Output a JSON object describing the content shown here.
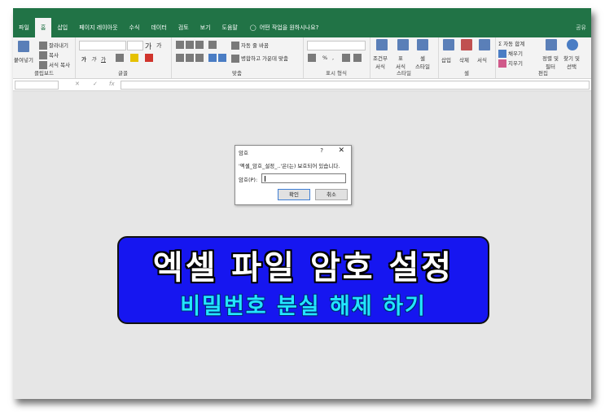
{
  "ribbon": {
    "tabs": [
      "파일",
      "홈",
      "삽입",
      "페이지 레이아웃",
      "수식",
      "데이터",
      "검토",
      "보기",
      "도움말"
    ],
    "tell_me": "어떤 작업을 원하시나요?",
    "share": "공유"
  },
  "clipboard": {
    "paste": "붙여넣기",
    "cut": "잘라내기",
    "copy": "복사",
    "format_painter": "서식 복사",
    "label": "클립보드"
  },
  "font": {
    "bold": "가",
    "italic": "가",
    "underline": "가",
    "grow": "가",
    "shrink": "가",
    "label": "글꼴"
  },
  "alignment": {
    "wrap": "자동 줄 바꿈",
    "merge": "병합하고 가운데 맞춤",
    "label": "맞춤"
  },
  "number": {
    "percent": "%",
    "comma": ",",
    "label": "표시 형식"
  },
  "styles": {
    "conditional": "조건부\n서식",
    "table": "표\n서식",
    "cell": "셀\n스타일",
    "label": "스타일"
  },
  "cells": {
    "insert": "삽입",
    "delete": "삭제",
    "format": "서식",
    "label": "셀"
  },
  "editing": {
    "autosum": "자동 합계",
    "fill": "채우기",
    "clear": "지우기",
    "sort": "정렬 및\n필터",
    "find": "찾기 및\n선택",
    "label": "편집"
  },
  "formula": {
    "fx": "fx"
  },
  "dialog": {
    "title": "암호",
    "help": "?",
    "close": "✕",
    "message": "'엑셀_암호_설정_..'은(는) 보호되어 있습니다.",
    "password_label": "암호(P):",
    "ok": "확인",
    "cancel": "취소"
  },
  "banner": {
    "title": "엑셀 파일 암호 설정",
    "subtitle": "비밀번호 분실 해제 하기"
  }
}
